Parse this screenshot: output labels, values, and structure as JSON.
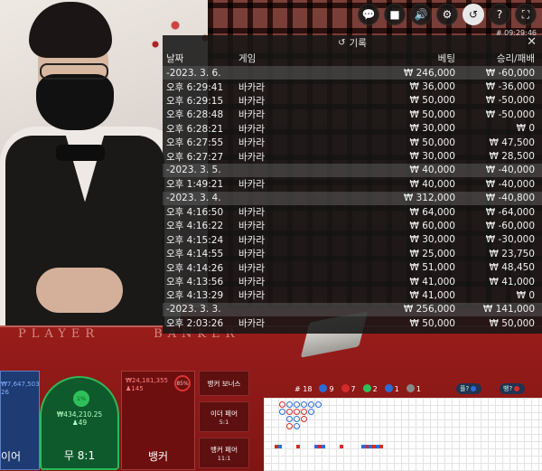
{
  "toolbar": {
    "buttons": [
      {
        "icon": "chat-icon",
        "glyph": "💬"
      },
      {
        "icon": "video-icon",
        "glyph": "■"
      },
      {
        "icon": "volume-icon",
        "glyph": "🔊"
      },
      {
        "icon": "settings-icon",
        "glyph": "⚙"
      },
      {
        "icon": "history-icon",
        "glyph": "↺"
      },
      {
        "icon": "help-icon",
        "glyph": "?"
      },
      {
        "icon": "fullscreen-icon",
        "glyph": "⛶"
      }
    ],
    "clock": "09:29:46"
  },
  "history": {
    "title": "기록",
    "columns": [
      "날짜",
      "게임",
      "베팅",
      "승리/패배"
    ],
    "rows": [
      {
        "type": "date",
        "c1": "-2023. 3. 6.",
        "c2": "",
        "c3": "₩ 246,000",
        "c4": "₩ -60,000"
      },
      {
        "type": "game",
        "c1": "오후 6:29:41",
        "c2": "바카라",
        "c3": "₩ 36,000",
        "c4": "₩ -36,000"
      },
      {
        "type": "game",
        "c1": "오후 6:29:15",
        "c2": "바카라",
        "c3": "₩ 50,000",
        "c4": "₩ -50,000"
      },
      {
        "type": "game",
        "c1": "오후 6:28:48",
        "c2": "바카라",
        "c3": "₩ 50,000",
        "c4": "₩ -50,000"
      },
      {
        "type": "game",
        "c1": "오후 6:28:21",
        "c2": "바카라",
        "c3": "₩ 30,000",
        "c4": "₩ 0"
      },
      {
        "type": "game",
        "c1": "오후 6:27:55",
        "c2": "바카라",
        "c3": "₩ 50,000",
        "c4": "₩ 47,500"
      },
      {
        "type": "game",
        "c1": "오후 6:27:27",
        "c2": "바카라",
        "c3": "₩ 30,000",
        "c4": "₩ 28,500"
      },
      {
        "type": "date",
        "c1": "-2023. 3. 5.",
        "c2": "",
        "c3": "₩ 40,000",
        "c4": "₩ -40,000"
      },
      {
        "type": "game",
        "c1": "오후 1:49:21",
        "c2": "바카라",
        "c3": "₩ 40,000",
        "c4": "₩ -40,000"
      },
      {
        "type": "date",
        "c1": "-2023. 3. 4.",
        "c2": "",
        "c3": "₩ 312,000",
        "c4": "₩ -40,800"
      },
      {
        "type": "game",
        "c1": "오후 4:16:50",
        "c2": "바카라",
        "c3": "₩ 64,000",
        "c4": "₩ -64,000"
      },
      {
        "type": "game",
        "c1": "오후 4:16:22",
        "c2": "바카라",
        "c3": "₩ 60,000",
        "c4": "₩ -60,000"
      },
      {
        "type": "game",
        "c1": "오후 4:15:24",
        "c2": "바카라",
        "c3": "₩ 30,000",
        "c4": "₩ -30,000"
      },
      {
        "type": "game",
        "c1": "오후 4:14:55",
        "c2": "바카라",
        "c3": "₩ 25,000",
        "c4": "₩ 23,750"
      },
      {
        "type": "game",
        "c1": "오후 4:14:26",
        "c2": "바카라",
        "c3": "₩ 51,000",
        "c4": "₩ 48,450"
      },
      {
        "type": "game",
        "c1": "오후 4:13:56",
        "c2": "바카라",
        "c3": "₩ 41,000",
        "c4": "₩ 41,000"
      },
      {
        "type": "game",
        "c1": "오후 4:13:29",
        "c2": "바카라",
        "c3": "₩ 41,000",
        "c4": "₩ 0"
      },
      {
        "type": "date",
        "c1": "-2023. 3. 3.",
        "c2": "",
        "c3": "₩ 256,000",
        "c4": "₩ 141,000"
      },
      {
        "type": "game",
        "c1": "오후 2:03:26",
        "c2": "바카라",
        "c3": "₩ 50,000",
        "c4": "₩ 50,000"
      }
    ]
  },
  "table": {
    "felt_left": "PLAYER",
    "felt_right": "BANKER"
  },
  "bets": {
    "player": {
      "amount": "₩7,647,503",
      "sub": "26",
      "label": "이어"
    },
    "tie": {
      "pct": "1%",
      "amount": "₩434,210.25",
      "players": "49",
      "label": "무 8:1"
    },
    "banker": {
      "amount": "₩24,181,355",
      "sub": "145",
      "pct": "85%",
      "label": "뱅커"
    },
    "side": {
      "bonus": "뱅커 보너스",
      "player_pair": "이더 페어",
      "player_pair_odds": "5:1",
      "banker_pair": "뱅커 페어",
      "banker_pair_odds": "11:1"
    }
  },
  "roadmap": {
    "round": "# 18",
    "counts": [
      {
        "label": "P",
        "value": "9",
        "color": "#2a6cd6"
      },
      {
        "label": "B",
        "value": "7",
        "color": "#d62a2a"
      },
      {
        "label": "T",
        "value": "2",
        "color": "#2fbf5a"
      },
      {
        "label": "PP",
        "value": "1",
        "color": "#2a6cd6"
      },
      {
        "label": "BP",
        "value": "1",
        "color": "#888888"
      }
    ],
    "predict_player": "플?",
    "predict_banker": "뱅?"
  },
  "colors": {
    "panel_bg": "#161616",
    "date_row": "#5a5a5a",
    "player": "#2a6cd6",
    "banker": "#d62a2a",
    "tie": "#2fbf5a"
  }
}
